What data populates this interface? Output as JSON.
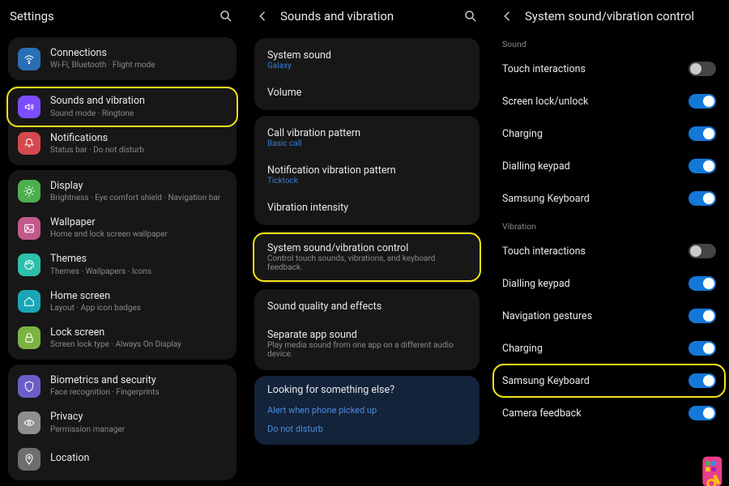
{
  "panel1": {
    "header": {
      "title": "Settings"
    },
    "groups": [
      [
        {
          "title": "Connections",
          "sub": "Wi-Fi, Bluetooth  ·  Flight mode",
          "icon": "wifi",
          "color": "blue"
        }
      ],
      [
        {
          "title": "Sounds and vibration",
          "sub": "Sound mode  ·  Ringtone",
          "icon": "volume",
          "color": "purple",
          "highlight": true
        },
        {
          "title": "Notifications",
          "sub": "Status bar  ·  Do not disturb",
          "icon": "bell",
          "color": "red"
        }
      ],
      [
        {
          "title": "Display",
          "sub": "Brightness  ·  Eye comfort shield  ·  Navigation bar",
          "icon": "sun",
          "color": "green"
        },
        {
          "title": "Wallpaper",
          "sub": "Home and lock screen wallpaper",
          "icon": "image",
          "color": "pink"
        },
        {
          "title": "Themes",
          "sub": "Themes  ·  Wallpapers  ·  Icons",
          "icon": "palette",
          "color": "cyan"
        },
        {
          "title": "Home screen",
          "sub": "Layout  ·  App icon badges",
          "icon": "home",
          "color": "teal"
        },
        {
          "title": "Lock screen",
          "sub": "Screen lock type  ·  Always On Display",
          "icon": "lock",
          "color": "lgreen"
        }
      ],
      [
        {
          "title": "Biometrics and security",
          "sub": "Face recognition  ·  Fingerprints",
          "icon": "shield",
          "color": "violet"
        },
        {
          "title": "Privacy",
          "sub": "Permission manager",
          "icon": "eye",
          "color": "grey"
        },
        {
          "title": "Location",
          "sub": "",
          "icon": "pin",
          "color": "dgrey"
        }
      ]
    ]
  },
  "panel2": {
    "header": {
      "title": "Sounds and vibration"
    },
    "cards": [
      [
        {
          "title": "System sound",
          "sub": "Galaxy",
          "subColor": "blue"
        },
        {
          "title": "Volume"
        }
      ],
      [
        {
          "title": "Call vibration pattern",
          "sub": "Basic call",
          "subColor": "blue"
        },
        {
          "title": "Notification vibration pattern",
          "sub": "Ticktock",
          "subColor": "blue"
        },
        {
          "title": "Vibration intensity"
        }
      ],
      [
        {
          "title": "System sound/vibration control",
          "sub": "Control touch sounds, vibrations, and keyboard feedback.",
          "subColor": "grey",
          "highlight": true
        }
      ],
      [
        {
          "title": "Sound quality and effects"
        },
        {
          "title": "Separate app sound",
          "sub": "Play media sound from one app on a different audio device.",
          "subColor": "grey"
        }
      ]
    ],
    "footer": {
      "title": "Looking for something else?",
      "links": [
        "Alert when phone picked up",
        "Do not disturb"
      ]
    }
  },
  "panel3": {
    "header": {
      "title": "System sound/vibration control"
    },
    "sections": [
      {
        "label": "Sound",
        "items": [
          {
            "label": "Touch interactions",
            "on": false
          },
          {
            "label": "Screen lock/unlock",
            "on": true
          },
          {
            "label": "Charging",
            "on": true
          },
          {
            "label": "Dialling keypad",
            "on": true
          },
          {
            "label": "Samsung Keyboard",
            "on": true
          }
        ]
      },
      {
        "label": "Vibration",
        "items": [
          {
            "label": "Touch interactions",
            "on": false
          },
          {
            "label": "Dialling keypad",
            "on": true
          },
          {
            "label": "Navigation gestures",
            "on": true
          },
          {
            "label": "Charging",
            "on": true
          },
          {
            "label": "Samsung Keyboard",
            "on": true,
            "highlight": true
          },
          {
            "label": "Camera feedback",
            "on": true
          }
        ]
      }
    ]
  }
}
